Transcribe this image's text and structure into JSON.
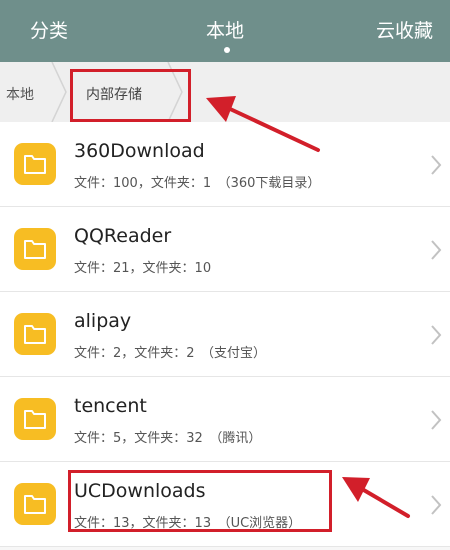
{
  "tabs": {
    "category": "分类",
    "local": "本地",
    "cloud": "云收藏"
  },
  "breadcrumb": {
    "root": "本地",
    "current": "内部存储"
  },
  "files": [
    {
      "name": "360Download",
      "meta": "文件：100，文件夹：1　（360下载目录）"
    },
    {
      "name": "QQReader",
      "meta": "文件：21，文件夹：10"
    },
    {
      "name": "alipay",
      "meta": "文件：2，文件夹：2　（支付宝）"
    },
    {
      "name": "tencent",
      "meta": "文件：5，文件夹：32　（腾讯）"
    },
    {
      "name": "UCDownloads",
      "meta": "文件：13，文件夹：13　（UC浏览器）"
    }
  ],
  "colors": {
    "topbar": "#6f8f8b",
    "folder": "#f7bd23",
    "annotation": "#d21f2a"
  },
  "icons": {
    "folder": "folder-icon",
    "chevron": "chevron-right-icon",
    "breadcrumb_separator": "chevron-separator-icon"
  }
}
